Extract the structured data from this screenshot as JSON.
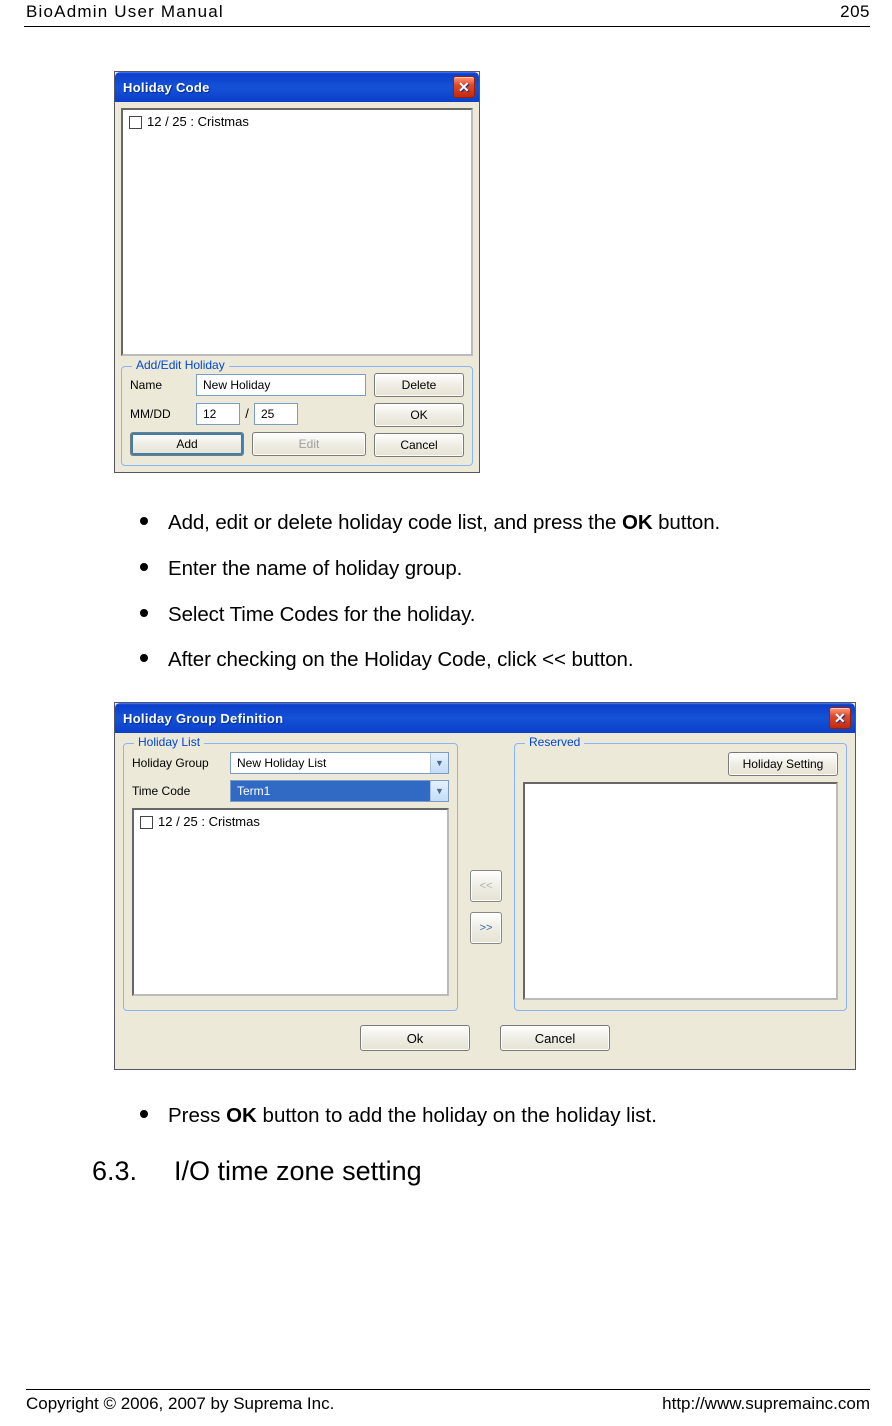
{
  "page": {
    "header_title": "BioAdmin  User  Manual",
    "header_page": "205",
    "footer_copyright": "Copyright © 2006, 2007 by Suprema Inc.",
    "footer_url": "http://www.supremainc.com"
  },
  "dialog1": {
    "title": "Holiday Code",
    "list_item": "12 / 25 : Cristmas",
    "fieldset_legend": "Add/Edit Holiday",
    "name_label": "Name",
    "name_value": "New Holiday",
    "date_label": "MM/DD",
    "mm_value": "12",
    "date_sep": "/",
    "dd_value": "25",
    "btn_add": "Add",
    "btn_edit": "Edit",
    "btn_delete": "Delete",
    "btn_ok": "OK",
    "btn_cancel": "Cancel"
  },
  "bullets_a": [
    {
      "pre": "Add, edit or delete holiday code list, and press the ",
      "bold": "OK",
      "post": " button."
    },
    {
      "pre": "Enter the name of holiday group.",
      "bold": "",
      "post": ""
    },
    {
      "pre": "Select Time Codes for the holiday.",
      "bold": "",
      "post": ""
    },
    {
      "pre": "After checking on the Holiday Code, click << button.",
      "bold": "",
      "post": ""
    }
  ],
  "dialog2": {
    "title": "Holiday Group Definition",
    "left_legend": "Holiday List",
    "group_label": "Holiday Group",
    "group_value": "New Holiday List",
    "timecode_label": "Time Code",
    "timecode_value": "Term1",
    "list_item": "12 / 25 : Cristmas",
    "btn_left": "<<",
    "btn_right": ">>",
    "right_legend": "Reserved",
    "btn_holiday_setting": "Holiday Setting",
    "btn_ok": "Ok",
    "btn_cancel": "Cancel"
  },
  "bullets_b": [
    {
      "pre": "Press ",
      "bold": "OK",
      "post": " button to add the holiday on the holiday list."
    }
  ],
  "section": {
    "number": "6.3.",
    "title": "I/O time zone setting"
  }
}
